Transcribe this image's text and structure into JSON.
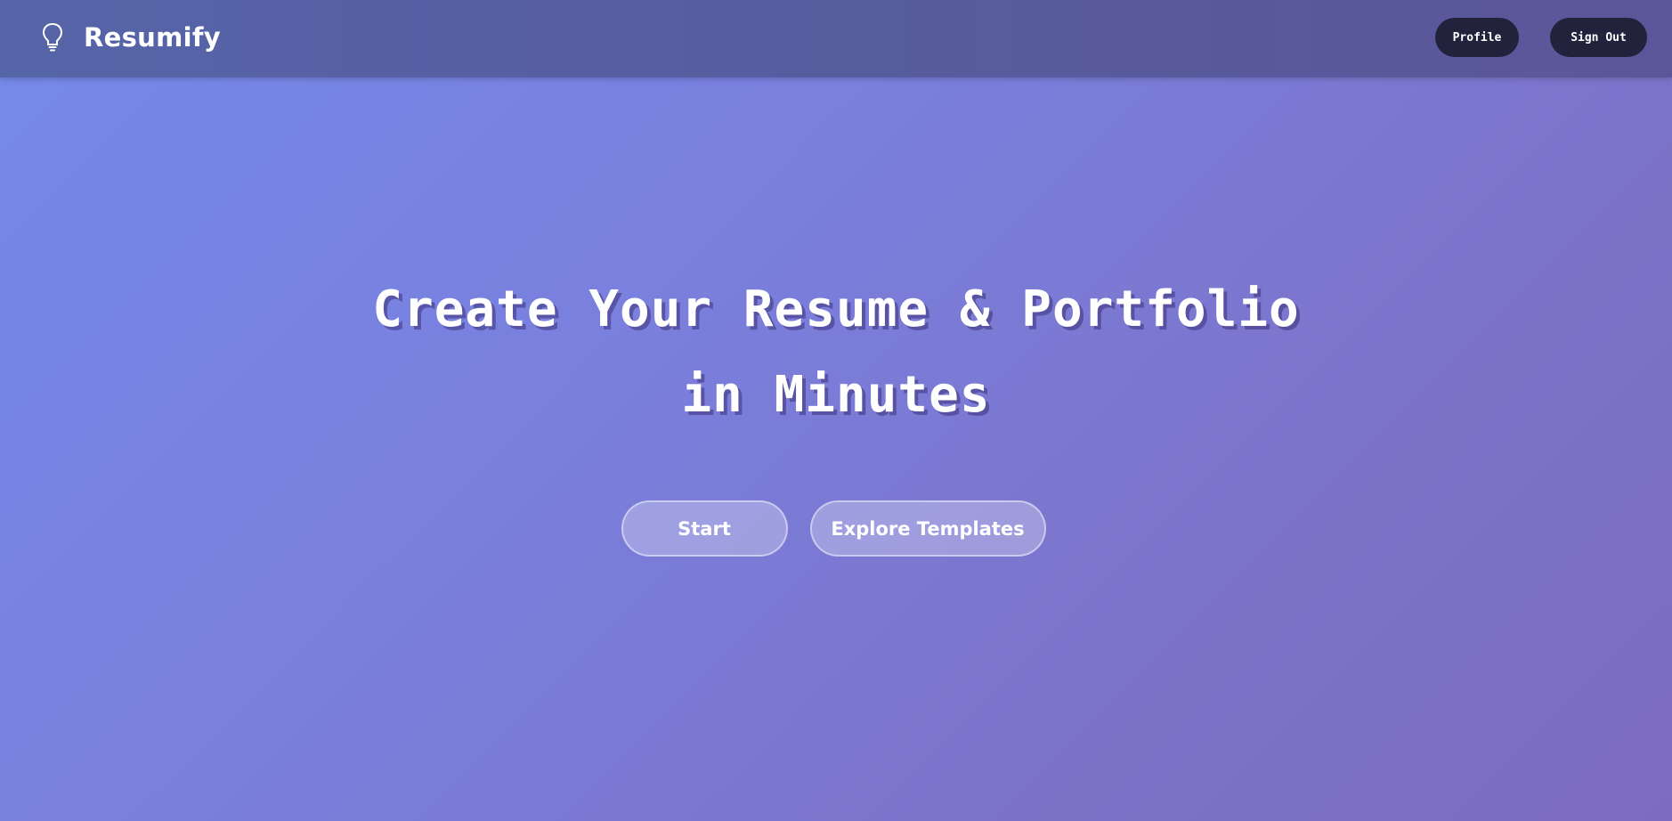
{
  "header": {
    "brand_name": "Resumify",
    "logo_icon": "lightbulb-icon",
    "profile_label": "Profile",
    "signout_label": "Sign Out"
  },
  "hero": {
    "title_line1": "Create Your Resume & Portfolio",
    "title_line2": "in Minutes",
    "start_label": "Start",
    "explore_label": "Explore Templates"
  },
  "colors": {
    "nav_bg": "#5665a8",
    "nav_button_bg": "#23223d",
    "gradient_start": "#7589ea",
    "gradient_end": "#7c6bc2",
    "text": "#ffffff"
  }
}
